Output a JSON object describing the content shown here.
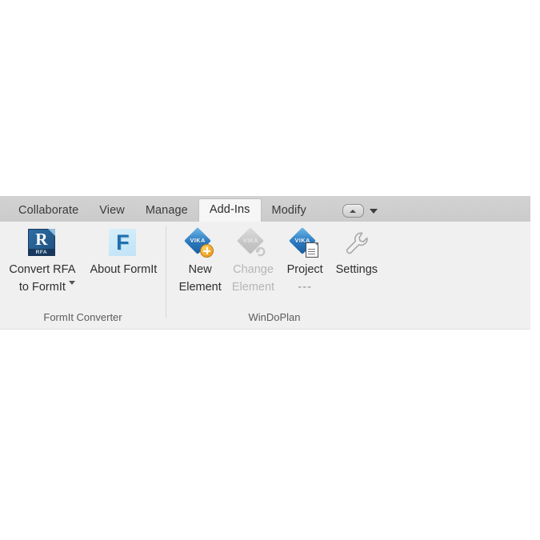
{
  "app": {
    "ribbon_theme_bg": "#f0f0f0",
    "tabstrip_bg": "#cfcfcf",
    "accent_blue": "#2a79c0",
    "accent_orange": "#f0a323"
  },
  "tabs": {
    "items": [
      {
        "label": "Collaborate",
        "active": false
      },
      {
        "label": "View",
        "active": false
      },
      {
        "label": "Manage",
        "active": false
      },
      {
        "label": "Add-Ins",
        "active": true
      },
      {
        "label": "Modify",
        "active": false
      }
    ],
    "minimize_control": {
      "icon": "ribbon-minimize-icon",
      "caret": "chevron-down-icon"
    }
  },
  "panels": [
    {
      "label": "FormIt Converter",
      "buttons": [
        {
          "name": "convert-rfa-to-formit",
          "line1": "Convert RFA",
          "line2": "to FormIt",
          "icon": "revit-rfa-file-icon",
          "icon_letter": "R",
          "icon_tag": "RFA",
          "has_dropdown": true,
          "enabled": true
        },
        {
          "name": "about-formit",
          "line1": "About FormIt",
          "line2": "",
          "icon": "formit-logo-icon",
          "icon_letter": "F",
          "has_dropdown": false,
          "enabled": true
        }
      ]
    },
    {
      "label": "WinDoPlan",
      "buttons": [
        {
          "name": "new-element",
          "line1": "New",
          "line2": "Element",
          "icon": "vika-diamond-plus-icon",
          "icon_text": "VIKA",
          "badge": "plus-badge",
          "enabled": true
        },
        {
          "name": "change-element",
          "line1": "Change",
          "line2": "Element",
          "icon": "vika-diamond-change-icon",
          "icon_text": "VIKA",
          "badge": "cycle-badge",
          "enabled": false
        },
        {
          "name": "project",
          "line1": "Project",
          "line2": "---",
          "icon": "vika-diamond-document-icon",
          "icon_text": "VIKA",
          "badge": "document-badge",
          "enabled": true
        },
        {
          "name": "settings",
          "line1": "Settings",
          "line2": "",
          "icon": "wrench-icon",
          "enabled": true
        }
      ]
    }
  ]
}
